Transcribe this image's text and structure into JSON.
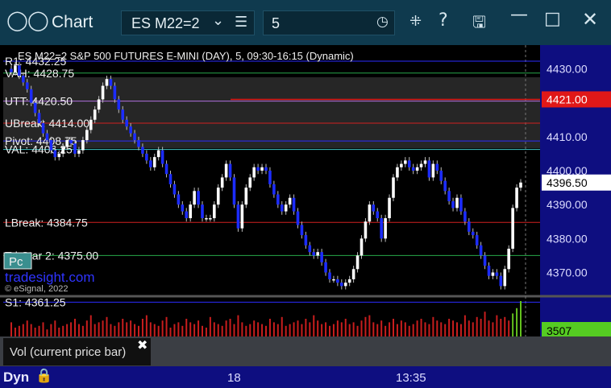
{
  "window": {
    "title": "Chart",
    "symbol": "ES M22=2",
    "interval": "5",
    "icons": [
      "layout-icon",
      "chevron-down-icon",
      "menu-icon",
      "clock-icon",
      "pin-icon",
      "help-icon",
      "save-icon",
      "minimize-icon",
      "maximize-icon",
      "close-icon"
    ]
  },
  "chart": {
    "header": "ES M22=2 S&P 500 FUTURES E-MINI (DAY), 5, 09:30-16:15 (Dynamic)",
    "watermark": "tradesight.com",
    "copyright": "© eSignal, 2022",
    "pc_badge": "Pc"
  },
  "chart_data": {
    "type": "candlestick",
    "ylim": [
      4363,
      4437
    ],
    "yticks": [
      "4430.00",
      "4420.00",
      "4410.00",
      "4400.00",
      "4390.00",
      "4380.00",
      "4370.00"
    ],
    "xticks": [
      "18",
      "13:35"
    ],
    "current_price": "4396.50",
    "alert_price": "4421.00",
    "levels": [
      {
        "label": "R1: 4432.25",
        "value": 4432.25,
        "color": "#2c2cff"
      },
      {
        "label": "VAH: 4428.75",
        "value": 4428.75,
        "color": "#27a84a"
      },
      {
        "label": "UTT: 4420.50",
        "value": 4420.5,
        "color": "#b070e0"
      },
      {
        "label": "UBreak: 4414.00",
        "value": 4414.0,
        "color": "#d02020"
      },
      {
        "label": "Pivot: 4408.75",
        "value": 4408.75,
        "color": "#2c2cff"
      },
      {
        "label": "VAL: 4406.25",
        "value": 4406.25,
        "color": "#40c8c8"
      },
      {
        "label": "LBreak: 4384.75",
        "value": 4384.75,
        "color": "#d02020"
      },
      {
        "label": "Tri-Star 2: 4375.00",
        "value": 4375.0,
        "color": "#27a84a"
      },
      {
        "label": "S1: 4361.25",
        "value": 4361.25,
        "color": "#2c2cff"
      }
    ],
    "close": [
      4429,
      4431,
      4428,
      4426,
      4424,
      4420,
      4417,
      4414,
      4411,
      4409,
      4406,
      4404,
      4405,
      4407,
      4409,
      4408,
      4405,
      4406,
      4409,
      4412,
      4415,
      4418,
      4421,
      4425,
      4427,
      4425,
      4421,
      4418,
      4415,
      4413,
      4411,
      4409,
      4407,
      4405,
      4403,
      4401,
      4404,
      4406,
      4402,
      4399,
      4396,
      4393,
      4390,
      4388,
      4386,
      4390,
      4394,
      4390,
      4386,
      4386,
      4386,
      4390,
      4395,
      4398,
      4402,
      4398,
      4390,
      4383,
      4390,
      4395,
      4398,
      4401,
      4400,
      4401,
      4400,
      4396,
      4393,
      4390,
      4388,
      4390,
      4392,
      4388,
      4384,
      4381,
      4378,
      4376,
      4375,
      4376,
      4373,
      4370,
      4368,
      4368,
      4367,
      4366,
      4367,
      4368,
      4371,
      4375,
      4380,
      4385,
      4390,
      4388,
      4386,
      4380,
      4386,
      4392,
      4398,
      4401,
      4402,
      4403,
      4401,
      4400,
      4401,
      4402,
      4403,
      4398,
      4402,
      4400,
      4397,
      4394,
      4391,
      4389,
      4392,
      4388,
      4385,
      4382,
      4381,
      4378,
      4375,
      4372,
      4369,
      4370,
      4369,
      4366,
      4371,
      4377,
      4389,
      4395,
      4396.5
    ],
    "volume": [
      8,
      5,
      6,
      7,
      9,
      7,
      5,
      6,
      8,
      4,
      7,
      9,
      5,
      6,
      7,
      8,
      10,
      7,
      6,
      9,
      12,
      7,
      8,
      9,
      11,
      7,
      6,
      8,
      10,
      8,
      9,
      7,
      6,
      10,
      12,
      8,
      7,
      6,
      9,
      11,
      5,
      7,
      8,
      6,
      10,
      8,
      7,
      9,
      6,
      5,
      11,
      8,
      7,
      6,
      9,
      10,
      7,
      12,
      8,
      6,
      7,
      9,
      8,
      7,
      6,
      10,
      8,
      7,
      11,
      6,
      7,
      8,
      9,
      7,
      10,
      8,
      12,
      9,
      7,
      8,
      6,
      7,
      9,
      8,
      10,
      7,
      8,
      6,
      9,
      11,
      12,
      8,
      7,
      9,
      6,
      8,
      10,
      7,
      9,
      8,
      6,
      7,
      9,
      10,
      8,
      7,
      11,
      9,
      8,
      7,
      10,
      9,
      8,
      7,
      12,
      9,
      8,
      11,
      10,
      14,
      9,
      8,
      12,
      10,
      11,
      9,
      13,
      16,
      20
    ]
  },
  "volume_panel": {
    "label": "Vol (current price bar)",
    "value": "3507"
  },
  "bottom": {
    "dyn": "Dyn"
  }
}
